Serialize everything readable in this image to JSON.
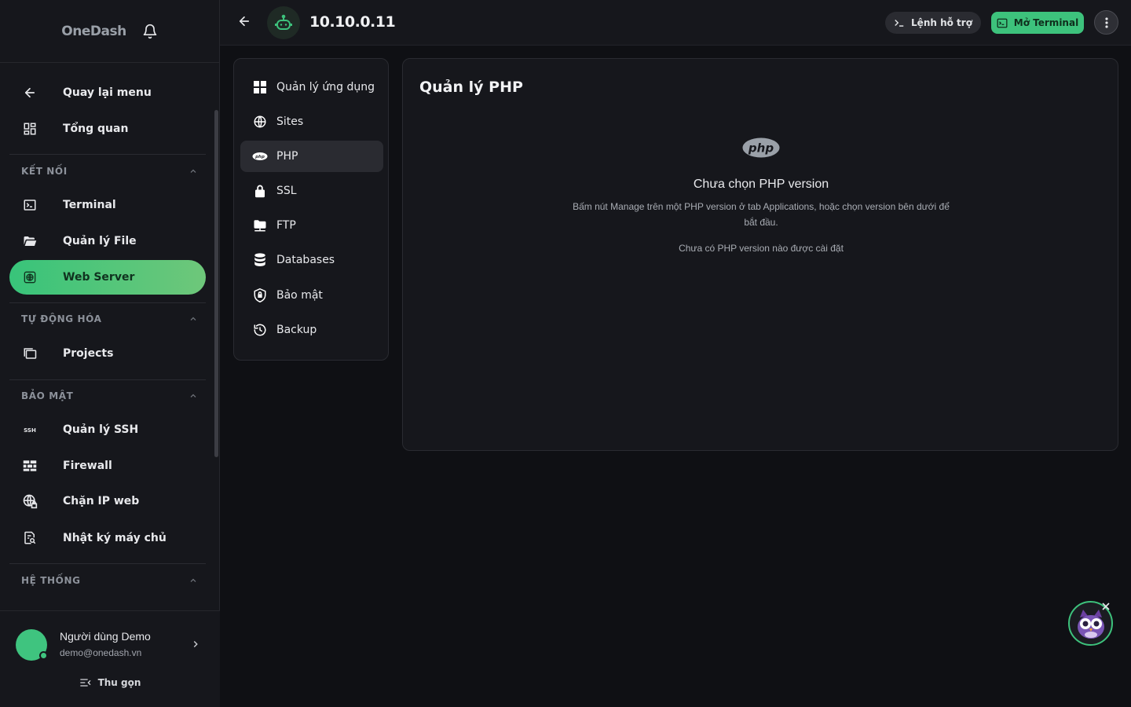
{
  "brand": {
    "name": "OneDash"
  },
  "sidebar": {
    "back": "Quay lại menu",
    "overview": "Tổng quan",
    "sections": {
      "connect": "KẾT NỐI",
      "automation": "TỰ ĐỘNG HÓA",
      "security": "BẢO MẬT",
      "system": "HỆ THỐNG"
    },
    "items": {
      "terminal": "Terminal",
      "file": "Quản lý File",
      "webserver": "Web Server",
      "projects": "Projects",
      "ssh": "Quản lý SSH",
      "firewall": "Firewall",
      "blockip": "Chặn IP web",
      "logs": "Nhật ký máy chủ",
      "ssh_icon_text": "SSH"
    },
    "user": {
      "name": "Người dùng Demo",
      "email": "demo@onedash.vn"
    },
    "collapse": "Thu gọn"
  },
  "header": {
    "title": "10.10.0.11",
    "help_label": "Lệnh hỗ trợ",
    "terminal_label": "Mở Terminal"
  },
  "subnav": {
    "items": [
      "Quản lý ứng dụng",
      "Sites",
      "PHP",
      "SSL",
      "FTP",
      "Databases",
      "Bảo mật",
      "Backup"
    ],
    "active": "PHP"
  },
  "main": {
    "title": "Quản lý PHP",
    "logo_text": "php",
    "empty_title": "Chưa chọn PHP version",
    "empty_desc": "Bấm nút Manage trên một PHP version ở tab Applications, hoặc chọn version bên dưới để bắt đầu.",
    "empty_note": "Chưa có PHP version nào được cài đặt"
  },
  "colors": {
    "accent": "#3dc27c",
    "background": "#0f1014",
    "panel": "#16171c"
  }
}
